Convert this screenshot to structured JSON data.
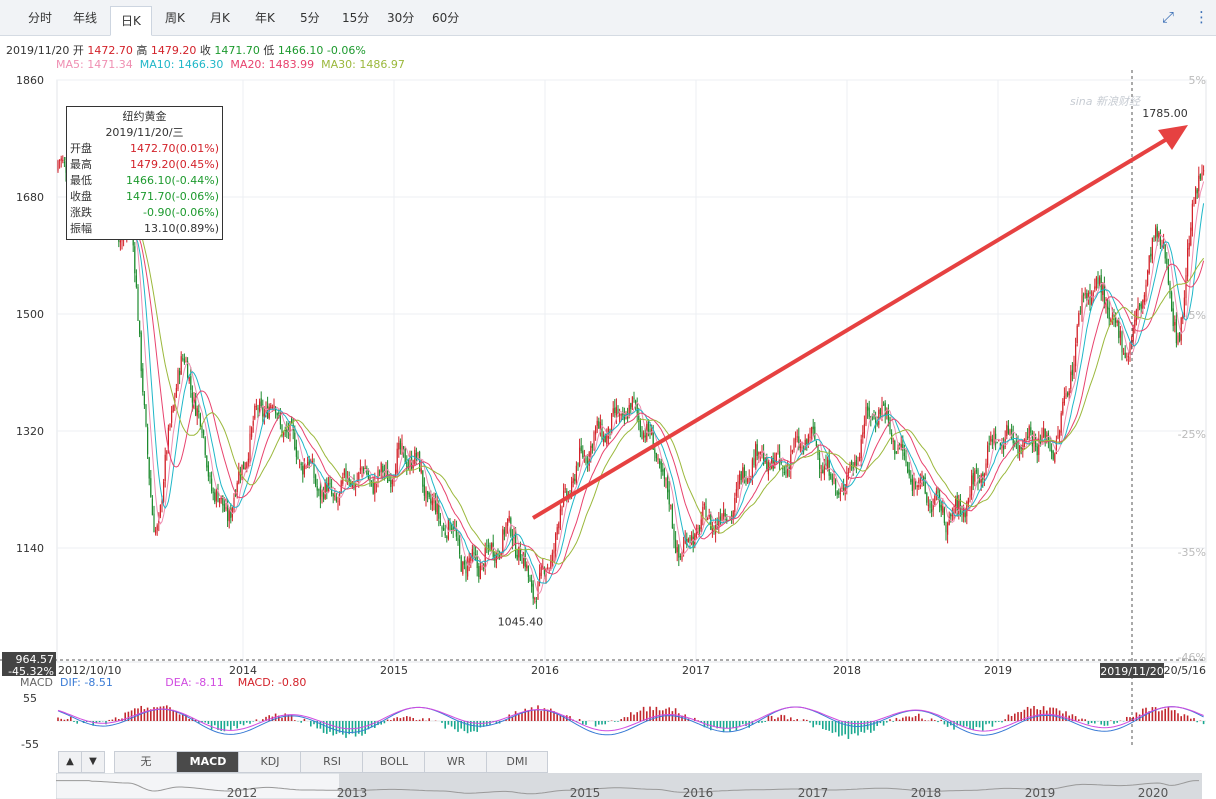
{
  "tabs": [
    "分时",
    "年线",
    "日K",
    "周K",
    "月K",
    "年K",
    "5分",
    "15分",
    "30分",
    "60分"
  ],
  "active_tab": "日K",
  "toolbar": {
    "expand_icon": "collapse-icon",
    "more_icon": "more-vertical-icon"
  },
  "info": {
    "date": "2019/11/20",
    "open_label": "开",
    "open": "1472.70",
    "high_label": "高",
    "high": "1479.20",
    "close_label": "收",
    "close": "1471.70",
    "low_label": "低",
    "low": "1466.10",
    "change": "-0.06%"
  },
  "ma": {
    "ma5": "MA5: 1471.34",
    "ma10": "MA10: 1466.30",
    "ma20": "MA20: 1483.99",
    "ma30": "MA30: 1486.97"
  },
  "tooltip": {
    "title": "纽约黄金",
    "date": "2019/11/20/三",
    "rows": [
      {
        "k": "开盘",
        "v": "1472.70(0.01%)",
        "c": "red"
      },
      {
        "k": "最高",
        "v": "1479.20(0.45%)",
        "c": "red"
      },
      {
        "k": "最低",
        "v": "1466.10(-0.44%)",
        "c": "green"
      },
      {
        "k": "收盘",
        "v": "1471.70(-0.06%)",
        "c": "green"
      },
      {
        "k": "涨跌",
        "v": "-0.90(-0.06%)",
        "c": "green"
      },
      {
        "k": "振幅",
        "v": "13.10(0.89%)",
        "c": "dark"
      }
    ]
  },
  "watermark": "sina 新浪财经",
  "annotations": {
    "low": "1045.40",
    "high": "1785.00"
  },
  "cursor": {
    "date": "2019/11/20",
    "price": "964.57",
    "pct": "-45.32%"
  },
  "start_date": "2012/10/10",
  "end_date": "2020/5/16",
  "macd": {
    "label": "MACD",
    "dif": "DIF: -8.51",
    "dea": "DEA: -8.11",
    "macd": "MACD: -0.80",
    "ymax": "55",
    "ymin": "-55"
  },
  "indicator_tabs": [
    "无",
    "MACD",
    "KDJ",
    "RSI",
    "BOLL",
    "WR",
    "DMI"
  ],
  "active_indicator": "MACD",
  "nav_years": [
    "2012",
    "2013",
    "2015",
    "2016",
    "2017",
    "2018",
    "2019",
    "2020"
  ],
  "chart_data": {
    "type": "line",
    "title": "纽约黄金",
    "x_tick_labels": [
      "2014",
      "2015",
      "2016",
      "2017",
      "2018",
      "2019"
    ],
    "y_tick_labels": [
      "1860",
      "1680",
      "1500",
      "1320",
      "1140"
    ],
    "y_pct_labels": [
      "5%",
      "-5%",
      "-25%",
      "-35%",
      "-46%"
    ],
    "ylim": [
      964.57,
      1860
    ],
    "grid": true,
    "x": [
      "2012-10",
      "2013-01",
      "2013-04",
      "2013-06",
      "2013-08",
      "2013-12",
      "2014-03",
      "2014-06",
      "2014-10",
      "2015-01",
      "2015-05",
      "2015-07",
      "2015-10",
      "2015-12",
      "2016-03",
      "2016-07",
      "2016-10",
      "2016-12",
      "2017-06",
      "2017-09",
      "2017-12",
      "2018-04",
      "2018-08",
      "2018-11",
      "2019-02",
      "2019-05",
      "2019-08",
      "2019-11",
      "2020-02",
      "2020-03",
      "2020-05"
    ],
    "series": [
      {
        "values": [
          1780,
          1690,
          1600,
          1200,
          1400,
          1200,
          1380,
          1250,
          1230,
          1280,
          1200,
          1090,
          1180,
          1060,
          1240,
          1360,
          1280,
          1140,
          1260,
          1300,
          1250,
          1340,
          1190,
          1230,
          1330,
          1280,
          1530,
          1470,
          1600,
          1480,
          1720
        ]
      }
    ],
    "annotations": [
      {
        "label": "1045.40",
        "x": "2015-12",
        "y": 1045.4
      },
      {
        "label": "1785.00",
        "x": "2020-05",
        "y": 1785.0
      }
    ]
  }
}
